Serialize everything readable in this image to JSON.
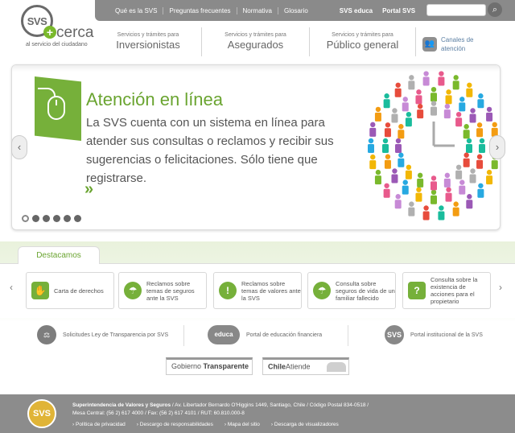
{
  "logo": {
    "mark": "SVS",
    "plus": "+",
    "word": "cerca",
    "tagline": "al servicio del ciudadano"
  },
  "topbar": {
    "links": [
      "Qué es la SVS",
      "Preguntas frecuentes",
      "Normativa",
      "Glosario"
    ],
    "svs_educa": "SVS educa",
    "portal_svs": "Portal SVS",
    "search_placeholder": ""
  },
  "mainnav": {
    "items": [
      {
        "small": "Servicios y trámites para",
        "big": "Inversionistas"
      },
      {
        "small": "Servicios y trámites para",
        "big": "Asegurados"
      },
      {
        "small": "Servicios y trámites para",
        "big": "Público general"
      }
    ],
    "canales": "Canales de atención"
  },
  "hero": {
    "title": "Atención en línea",
    "text": "La SVS cuenta con un sistema en línea para atender sus consultas o reclamos y recibir sus sugerencias o felicitaciones. Sólo tiene que registrarse.",
    "more": "»",
    "slides": 6,
    "active_slide": 1
  },
  "destacamos": {
    "tab": "Destacamos",
    "cards": [
      {
        "label": "Carta de derechos",
        "icon": "hand-icon"
      },
      {
        "label": "Reclamos sobre temas de seguros ante la SVS",
        "icon": "umbrella-icon"
      },
      {
        "label": "Reclamos sobre temas de valores ante la SVS",
        "icon": "alert-icon"
      },
      {
        "label": "Consulta sobre seguros de vida de un familiar fallecido",
        "icon": "umbrella-icon"
      },
      {
        "label": "Consulta sobre la existencia de acciones para el propietario",
        "icon": "question-icon"
      }
    ]
  },
  "links_row": [
    {
      "label": "Solicitudes Ley de Transparencia por SVS",
      "icon": "scales-icon"
    },
    {
      "label": "Portal de educación financiera",
      "icon": "svs-educa-icon",
      "brand": "educa"
    },
    {
      "label": "Portal institucional de la SVS",
      "icon": "svs-icon"
    }
  ],
  "gobierno": {
    "pre": "Gobierno ",
    "bold": "Transparente"
  },
  "chileatiende": {
    "bold": "Chile",
    "rest": "Atiende"
  },
  "footer": {
    "org": "Superintendencia de Valores y Seguros",
    "address": " / Av. Libertador Bernardo O'Higgins 1449, Santiago, Chile / Código Postal 834-0518 /",
    "phones": "Mesa Central: (56 2) 617 4000 / Fax: (56 2) 617 4101 / RUT: 60.810.000-8",
    "links": [
      "Política de privacidad",
      "Descargo de responsabilidades",
      "Mapa del sitio",
      "Descarga de visualizadores"
    ],
    "logo": "SVS"
  },
  "colors": {
    "brand_green": "#76b03a",
    "bar_gray": "#8a8a8a",
    "footer_gray": "#8c8c8c"
  }
}
